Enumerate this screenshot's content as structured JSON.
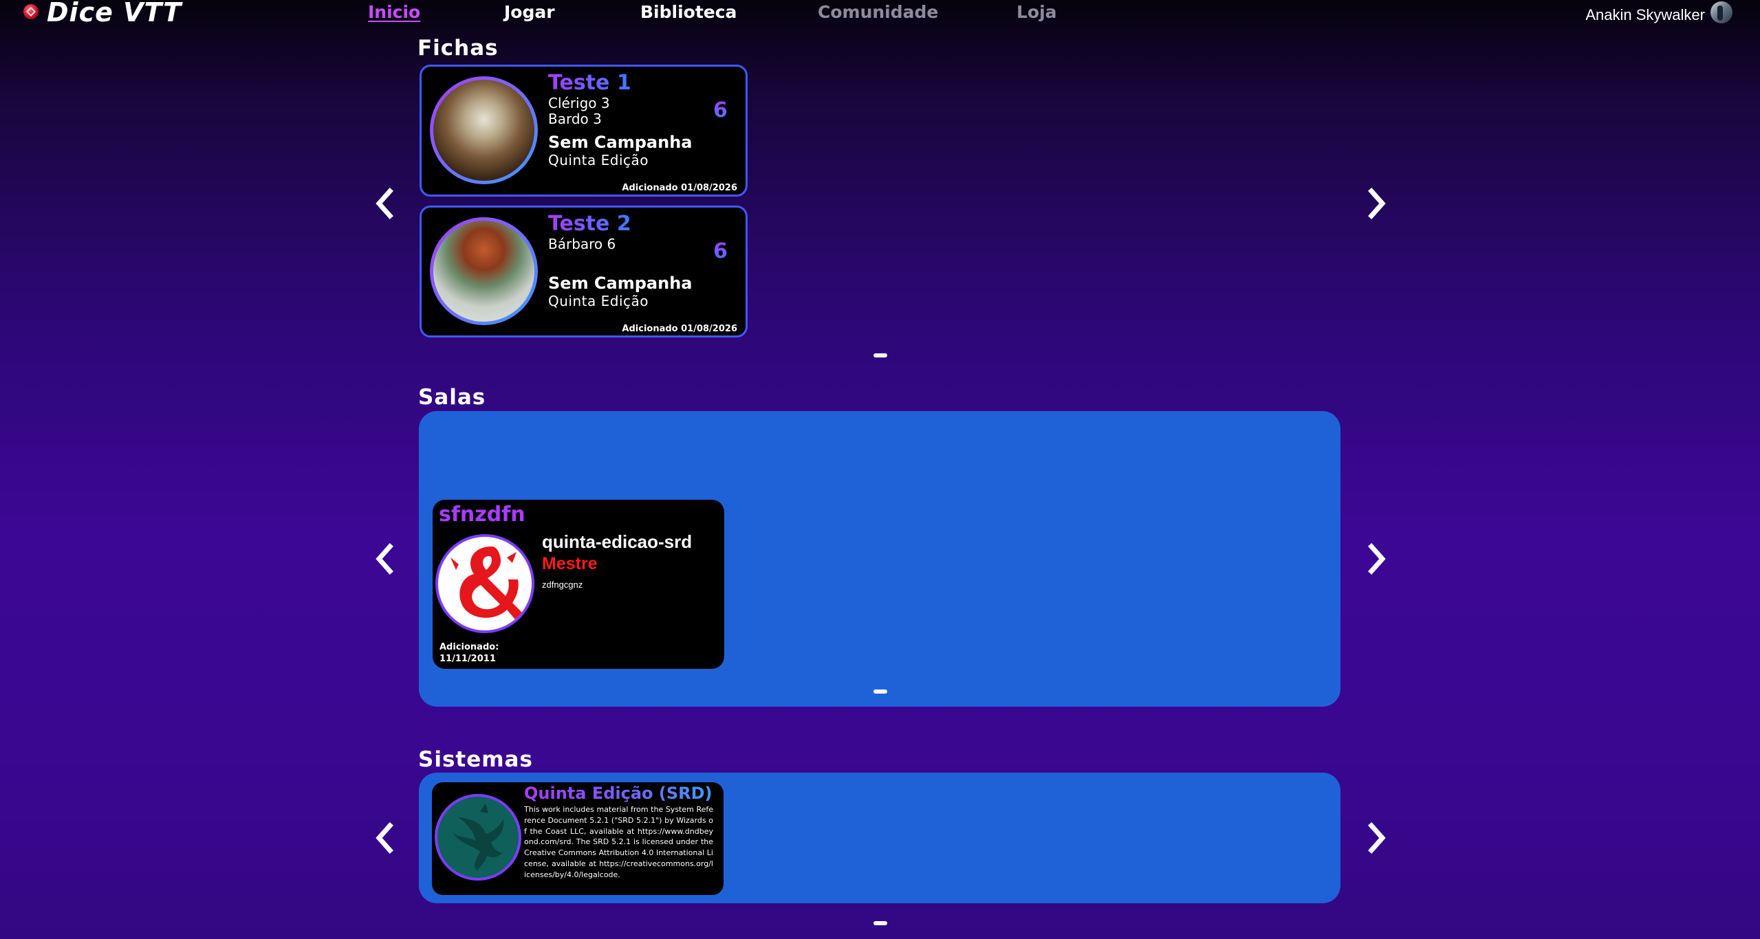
{
  "app": {
    "title": "Dice VTT",
    "logo_icon": "d20-icon"
  },
  "nav": [
    {
      "label": "Inicio",
      "state": "active"
    },
    {
      "label": "Jogar",
      "state": "normal"
    },
    {
      "label": "Biblioteca",
      "state": "normal"
    },
    {
      "label": "Comunidade",
      "state": "disabled"
    },
    {
      "label": "Loja",
      "state": "disabled"
    }
  ],
  "user": {
    "name": "Anakin Skywalker"
  },
  "sections": {
    "fichas": {
      "title": "Fichas"
    },
    "salas": {
      "title": "Salas"
    },
    "sistemas": {
      "title": "Sistemas"
    }
  },
  "fichas": [
    {
      "name": "Teste 1",
      "classes": [
        "Clérigo 3",
        "Bardo 3"
      ],
      "level": "6",
      "campaign": "Sem Campanha",
      "system": "Quinta Edição",
      "added": "Adicionado 01/08/2026"
    },
    {
      "name": "Teste 2",
      "classes": [
        "Bárbaro 6"
      ],
      "level": "6",
      "campaign": "Sem Campanha",
      "system": "Quinta Edição",
      "added": "Adicionado 01/08/2026"
    }
  ],
  "salas": [
    {
      "name": "sfnzdfn",
      "system": "quinta-edicao-srd",
      "role": "Mestre",
      "description": "zdfngcgnz",
      "added_label": "Adicionado:",
      "added_date": "11/11/2011"
    }
  ],
  "sistemas": [
    {
      "name": "Quinta Edição (SRD)",
      "description": "This work includes material from the System Reference Document 5.2.1 (\"SRD 5.2.1\") by Wizards of the Coast LLC, available at https://www.dndbeyond.com/srd. The SRD 5.2.1 is licensed under the Creative Commons Attribution 4.0 International License, available at https://creativecommons.org/licenses/by/4.0/legalcode."
    }
  ],
  "colors": {
    "accent": "#c84dff",
    "panel": "#1f62d8",
    "card_border": "#3f59ff",
    "role_master": "#ff1a1a"
  }
}
